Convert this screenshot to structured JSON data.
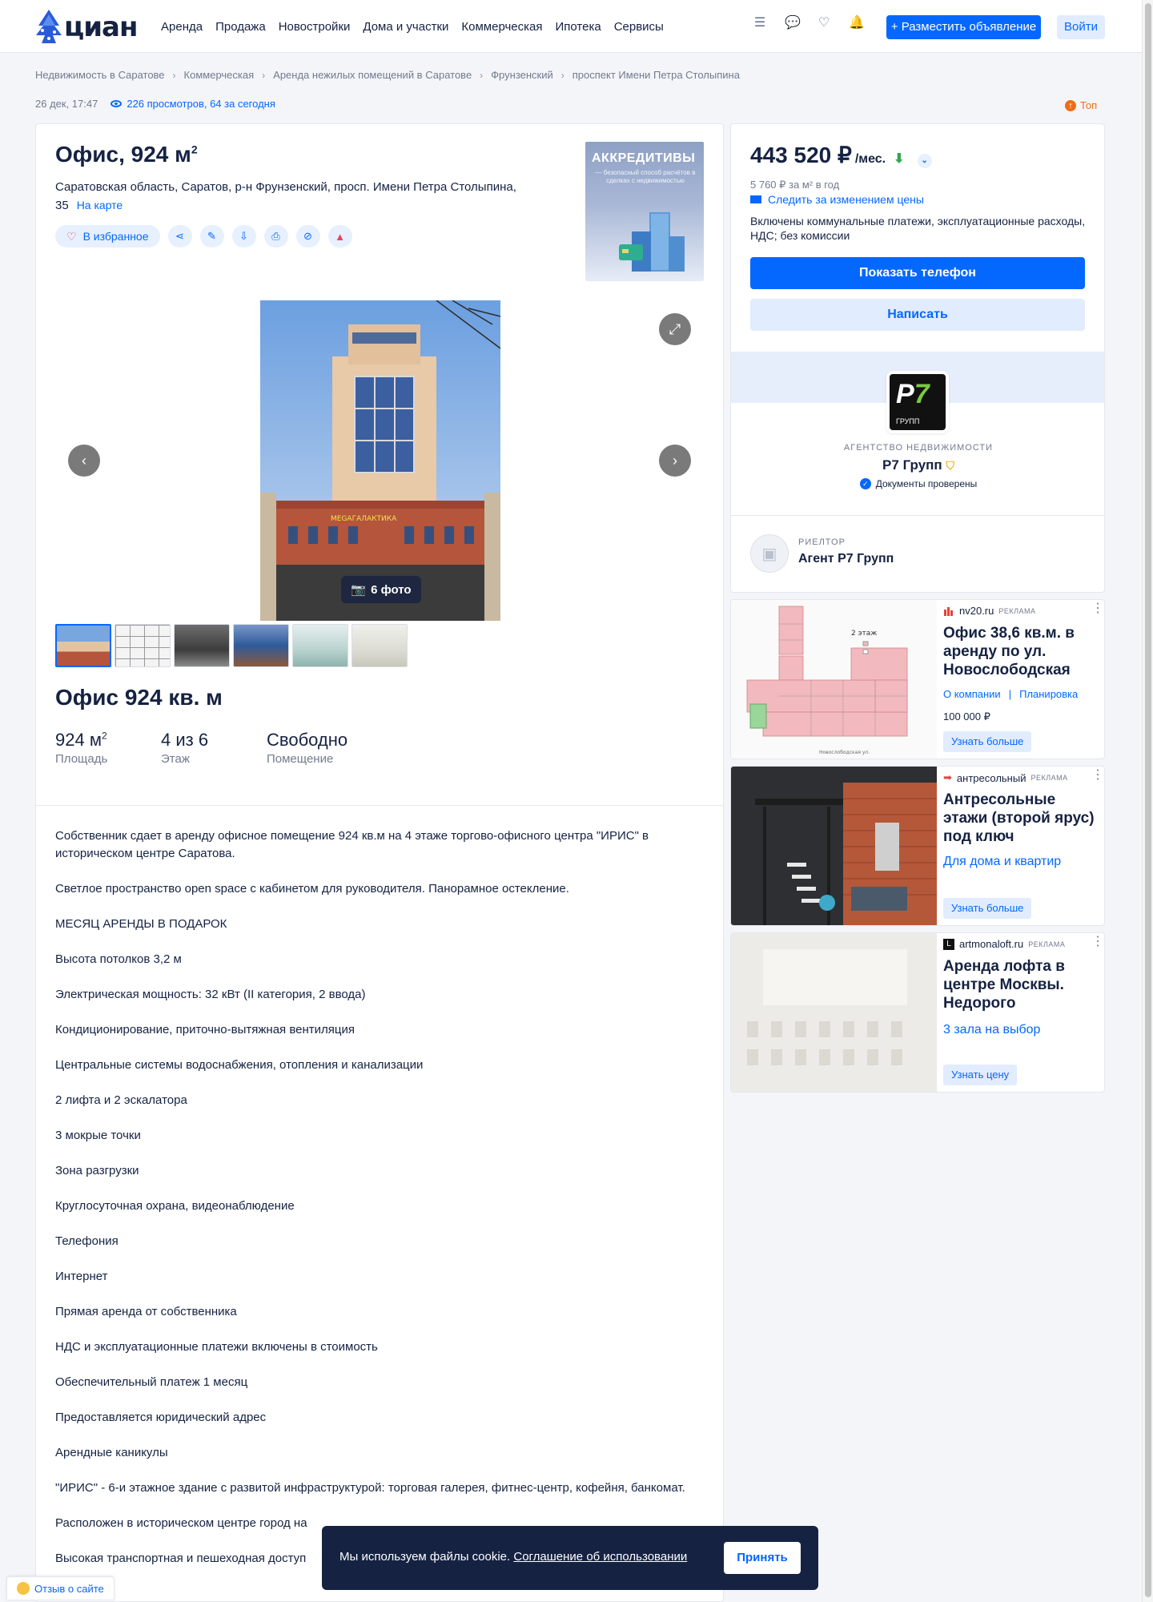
{
  "header": {
    "logo_text": "циан",
    "nav": [
      "Аренда",
      "Продажа",
      "Новостройки",
      "Дома и участки",
      "Коммерческая",
      "Ипотека",
      "Сервисы"
    ],
    "post_button": "+ Разместить объявление",
    "login_button": "Войти",
    "icons": [
      "compare-list-icon",
      "chat-icon",
      "heart-icon",
      "bell-icon"
    ]
  },
  "breadcrumbs": [
    "Недвижимость в Саратове",
    "Коммерческая",
    "Аренда нежилых помещений в Саратове",
    "Фрунзенский",
    "проспект Имени Петра Столыпина"
  ],
  "meta": {
    "date": "26 дек, 17:47",
    "views": "226 просмотров, 64 за сегодня",
    "top_badge": "Топ"
  },
  "listing": {
    "title_main": "Офис, 924 м",
    "title_sup": "2",
    "address": "Саратовская область, Саратов, р-н Фрунзенский, просп. Имени Петра Столыпина, 35",
    "map_link": "На карте",
    "favorite_label": "В избранное",
    "photo_count": "6 фото",
    "subtitle": "Офис 924 кв. м",
    "facts": [
      {
        "value": "924 м",
        "sup": "2",
        "label": "Площадь"
      },
      {
        "value": "4 из 6",
        "sup": "",
        "label": "Этаж"
      },
      {
        "value": "Свободно",
        "sup": "",
        "label": "Помещение"
      }
    ],
    "description": [
      "Собственник сдает в аренду офисное помещение 924 кв.м на 4 этаже торгово-офисного центра \"ИРИС\" в историческом центре Саратова.",
      "Светлое пространство open space с кабинетом для руководителя. Панорамное остекление.",
      "МЕСЯЦ АРЕНДЫ В ПОДАРОК",
      "Высота потолков 3,2 м",
      "Электрическая мощность: 32 кВт (II категория, 2 ввода)",
      "Кондиционирование, приточно-вытяжная вентиляция",
      "Центральные системы водоснабжения, отопления и канализации",
      "2 лифта и 2 эскалатора",
      "3 мокрые точки",
      "Зона разгрузки",
      "Круглосуточная охрана, видеонаблюдение",
      "Телефония",
      "Интернет",
      "Прямая аренда от собственника",
      "НДС и эксплуатационные платежи включены в стоимость",
      "Обеспечительный платеж 1 месяц",
      "Предоставляется юридический адрес",
      "Арендные каникулы",
      "\"ИРИС\" - 6-и этажное здание с развитой инфраструктурой: торговая галерея, фитнес-центр, кофейня, банкомат.",
      "Расположен в историческом центре город на",
      "Высокая транспортная и пешеходная доступ"
    ],
    "photo_sign": "MEGAГАЛАКТИКА"
  },
  "promo": {
    "title": "АККРЕДИТИВЫ",
    "subtitle": "— безопасный способ расчётов в сделках с недвижимостью"
  },
  "price_card": {
    "price": "443 520 ₽",
    "per": "/мес.",
    "per_sqm": "5 760 ₽ за м² в год",
    "watch": "Следить за изменением цены",
    "includes": "Включены коммунальные платежи, эксплуатационные расходы, НДС; без комиссии",
    "phone_button": "Показать телефон",
    "write_button": "Написать",
    "agency_logo_p": "P",
    "agency_logo_7": "7",
    "agency_logo_sub": "ГРУПП",
    "agency_kind": "АГЕНТСТВО НЕДВИЖИМОСТИ",
    "agency_name": "Р7 Групп",
    "docs": "Документы проверены",
    "realtor_kind": "РИЕЛТОР",
    "realtor_name": "Агент Р7 Групп"
  },
  "ads": [
    {
      "source": "nv20.ru",
      "tag": "РЕКЛАМА",
      "title": "Офис 38,6 кв.м. в аренду по ул. Новослободская",
      "links": [
        "О компании",
        "|",
        "Планировка"
      ],
      "price": "100 000 ₽",
      "button": "Узнать больше",
      "plan_label": "2 этаж",
      "plan_street": "Новослободская ул."
    },
    {
      "source": "антресольный",
      "tag": "РЕКЛАМА",
      "title": "Антресольные этажи (второй ярус) под ключ",
      "sub": "Для дома и квартир",
      "button": "Узнать больше"
    },
    {
      "source": "artmonaloft.ru",
      "tag": "РЕКЛАМА",
      "title": "Аренда лофта в центре Москвы. Недорого",
      "sub": "3 зала на выбор",
      "button": "Узнать цену"
    }
  ],
  "cookie": {
    "text": "Мы используем файлы cookie.",
    "link": "Соглашение об использовании",
    "button": "Принять"
  },
  "feedback": "Отзыв о сайте",
  "colors": {
    "brand": "#0468ff",
    "text": "#152242",
    "muted": "#737a8e",
    "top": "#f06d14"
  }
}
